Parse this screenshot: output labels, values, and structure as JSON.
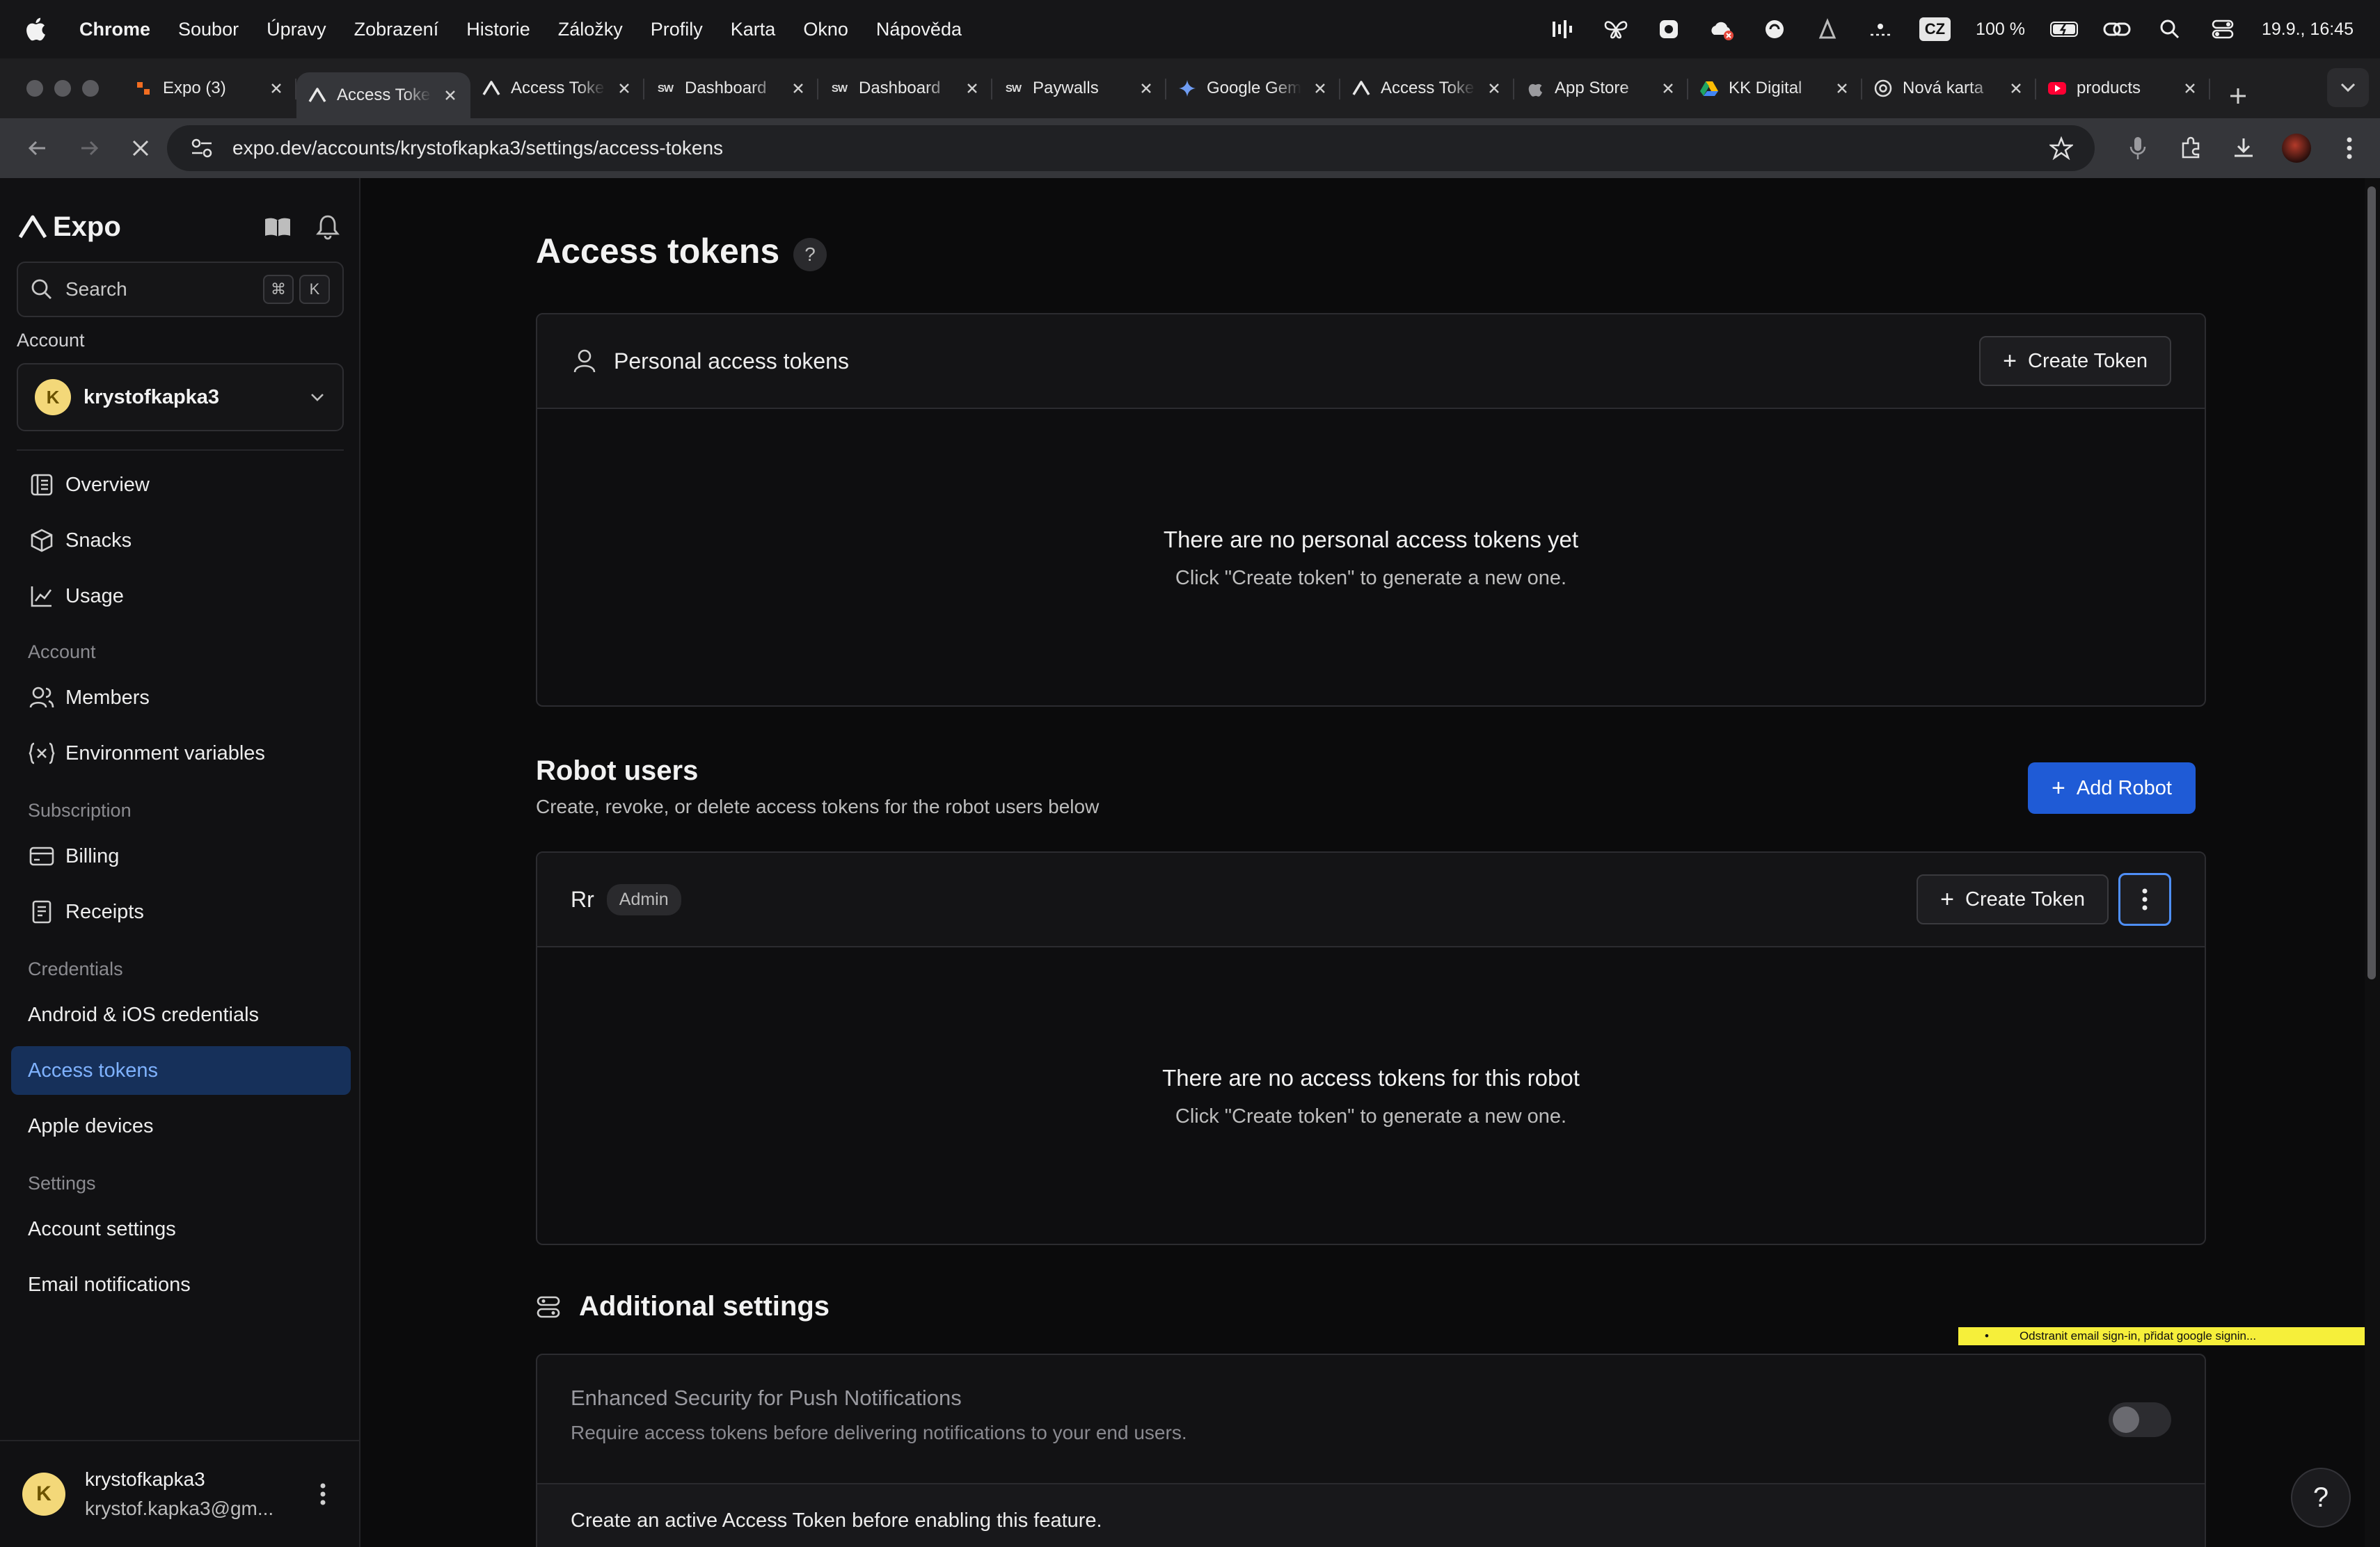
{
  "menubar": {
    "app_name": "Chrome",
    "items": [
      "Soubor",
      "Úpravy",
      "Zobrazení",
      "Historie",
      "Záložky",
      "Profily",
      "Karta",
      "Okno",
      "Nápověda"
    ],
    "input_source": "CZ",
    "battery": "100 %",
    "datetime": "19.9., 16:45"
  },
  "browser": {
    "tabs": [
      {
        "title": "Expo (3)",
        "favicon": "expo-orange-icon"
      },
      {
        "title": "Access Tokens",
        "favicon": "expo-logo-icon",
        "active": true
      },
      {
        "title": "Access Tokens",
        "favicon": "expo-logo-icon"
      },
      {
        "title": "Dashboard",
        "favicon": "sw-icon"
      },
      {
        "title": "Dashboard",
        "favicon": "sw-icon"
      },
      {
        "title": "Paywalls",
        "favicon": "sw-icon"
      },
      {
        "title": "Google Gemini",
        "favicon": "gemini-icon"
      },
      {
        "title": "Access Tokens",
        "favicon": "expo-logo-icon"
      },
      {
        "title": "App Store",
        "favicon": "apple-icon"
      },
      {
        "title": "KK Digital",
        "favicon": "google-drive-icon"
      },
      {
        "title": "Nová karta",
        "favicon": "chrome-icon"
      },
      {
        "title": "products",
        "favicon": "youtube-icon"
      }
    ],
    "url": "expo.dev/accounts/krystofkapka3/settings/access-tokens"
  },
  "sidebar": {
    "logo": "Expo",
    "search_placeholder": "Search",
    "search_kbd": [
      "⌘",
      "K"
    ],
    "account_label": "Account",
    "account_name": "krystofkapka3",
    "avatar_letter": "K",
    "nav_top": [
      {
        "label": "Overview",
        "icon": "overview-icon"
      },
      {
        "label": "Snacks",
        "icon": "snacks-icon"
      },
      {
        "label": "Usage",
        "icon": "usage-chart-icon"
      }
    ],
    "section_account": "Account",
    "nav_account": [
      {
        "label": "Members",
        "icon": "members-icon"
      },
      {
        "label": "Environment variables",
        "icon": "env-variables-icon"
      }
    ],
    "section_subscription": "Subscription",
    "nav_subscription": [
      {
        "label": "Billing",
        "icon": "billing-card-icon"
      },
      {
        "label": "Receipts",
        "icon": "receipt-icon"
      }
    ],
    "section_credentials": "Credentials",
    "nav_credentials": [
      {
        "label": "Android & iOS credentials"
      },
      {
        "label": "Access tokens",
        "active": true
      },
      {
        "label": "Apple devices"
      }
    ],
    "section_settings": "Settings",
    "nav_settings": [
      {
        "label": "Account settings"
      },
      {
        "label": "Email notifications"
      }
    ],
    "footer": {
      "username": "krystofkapka3",
      "email": "krystof.kapka3@gm..."
    }
  },
  "main": {
    "title": "Access tokens",
    "help_glyph": "?",
    "personal": {
      "title": "Personal access tokens",
      "create_button": "Create Token",
      "empty_title": "There are no personal access tokens yet",
      "empty_sub": "Click \"Create token\" to generate a new one."
    },
    "robots": {
      "title": "Robot users",
      "subtitle": "Create, revoke, or delete access tokens for the robot users below",
      "add_button": "Add Robot",
      "robot_name": "Rr",
      "robot_role": "Admin",
      "create_button": "Create Token",
      "empty_title": "There are no access tokens for this robot",
      "empty_sub": "Click \"Create token\" to generate a new one."
    },
    "additional": {
      "title": "Additional settings",
      "push_title": "Enhanced Security for Push Notifications",
      "push_sub": "Require access tokens before delivering notifications to your end users.",
      "push_enabled": false,
      "push_note": "Create an active Access Token before enabling this feature."
    }
  },
  "overlay_note": "Odstranit email sign-in, přidat google signin...",
  "colors": {
    "accent": "#1f5bd6",
    "active_nav_bg": "#16305a",
    "active_nav_text": "#7fb2ff",
    "sticky_note": "#f6ef3a",
    "avatar": "#f3d879"
  }
}
